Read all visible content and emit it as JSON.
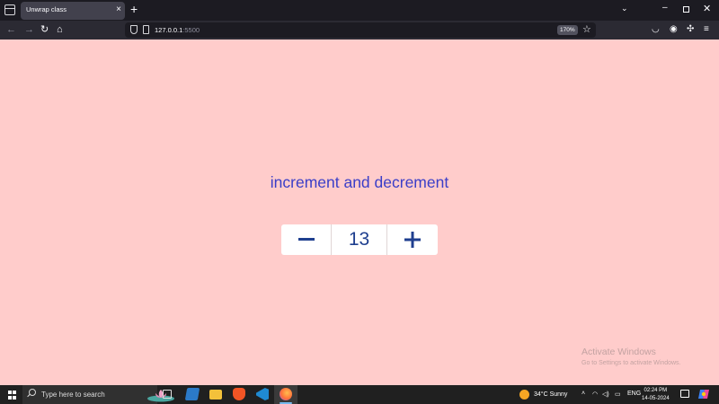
{
  "browser": {
    "tab_title": "Unwrap class",
    "tab_close": "×",
    "new_tab": "+",
    "list_all_tabs": "⌄",
    "url_host": "127.0.0.1",
    "url_port": ":5500",
    "zoom": "170%",
    "nav_back": "←",
    "nav_forward": "→",
    "nav_reload": "↻",
    "window_minimize": "–",
    "window_close": "✕"
  },
  "page": {
    "heading": "increment and decrement",
    "counter": {
      "decrement_label": "−",
      "value": "13",
      "increment_label": "+"
    },
    "watermark": {
      "title": "Activate Windows",
      "subtitle": "Go to Settings to activate Windows."
    },
    "colors": {
      "background": "#ffcccb",
      "heading": "#3a3ec8",
      "counter_text": "#1f3f8f"
    }
  },
  "taskbar": {
    "search_placeholder": "Type here to search",
    "weather": "34°C  Sunny",
    "language": "ENG",
    "time": "02:24 PM",
    "date": "14-05-2024"
  }
}
